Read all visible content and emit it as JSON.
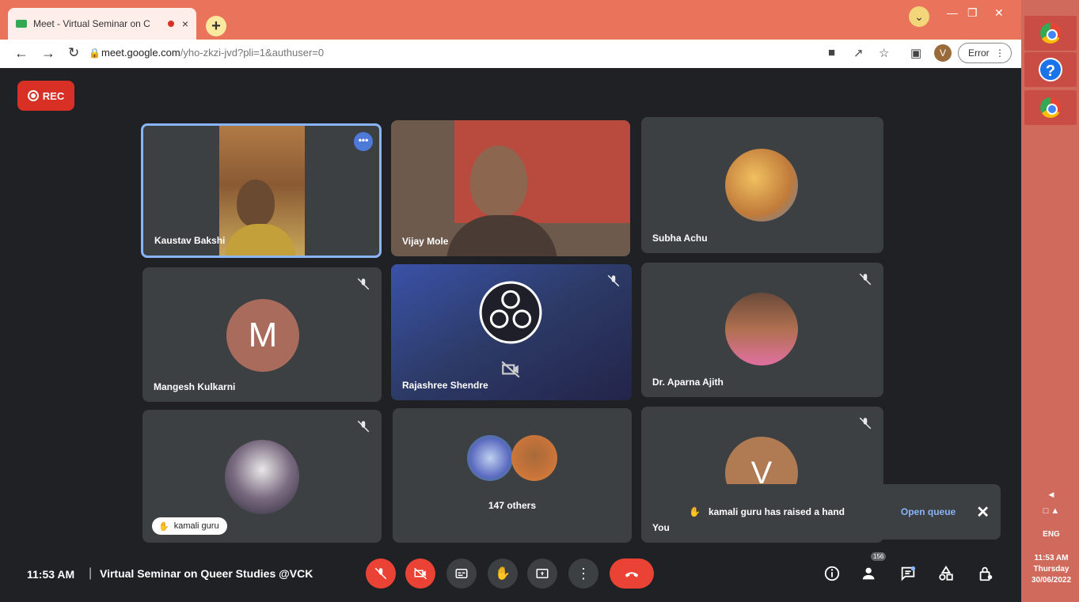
{
  "browser": {
    "tab_title": "Meet - Virtual Seminar on C",
    "tab_close": "×",
    "new_tab": "+",
    "url_host": "meet.google.com",
    "url_path": "/yho-zkzi-jvd?pli=1&authuser=0",
    "profile_initial": "V",
    "error_button": "Error"
  },
  "meet": {
    "rec_label": "REC",
    "participants": [
      {
        "name": "Kaustav Bakshi"
      },
      {
        "name": "Vijay Mole"
      },
      {
        "name": "Subha Achu"
      },
      {
        "name": "Mangesh Kulkarni",
        "initial": "M"
      },
      {
        "name": "Rajashree Shendre"
      },
      {
        "name": "Dr. Aparna Ajith"
      },
      {
        "name": "kamali guru"
      },
      {
        "name": "147 others"
      },
      {
        "name": "You",
        "initial": "V"
      }
    ],
    "toast": {
      "message": "kamali guru has raised a hand",
      "action": "Open queue"
    },
    "time": "11:53 AM",
    "separator": "|",
    "meeting_title": "Virtual Seminar on Queer Studies @VCK",
    "people_count": "156"
  },
  "taskbar": {
    "lang": "ENG",
    "time": "11:53 AM",
    "day": "Thursday",
    "date": "30/06/2022"
  },
  "colors": {
    "tab_bar": "#e9745b",
    "accent_red": "#ea4335",
    "tile_bg": "#3c4043",
    "meet_bg": "#202124",
    "link_blue": "#8ab4f8"
  }
}
